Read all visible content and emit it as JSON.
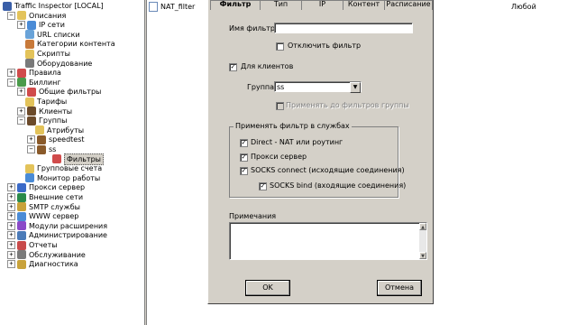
{
  "tree": {
    "items": [
      {
        "label": "Traffic Inspector [LOCAL]",
        "level": 0,
        "exp": "",
        "icon": "server-icon",
        "color": "#3a5fa8"
      },
      {
        "label": "Описания",
        "level": 1,
        "exp": "−",
        "icon": "folder-icon",
        "color": "#e3c35a"
      },
      {
        "label": "IP сети",
        "level": 2,
        "exp": "+",
        "icon": "network-icon",
        "color": "#4a8bd6"
      },
      {
        "label": "URL списки",
        "level": 2,
        "exp": "",
        "icon": "list-icon",
        "color": "#6aa3d8"
      },
      {
        "label": "Категории контента",
        "level": 2,
        "exp": "",
        "icon": "category-icon",
        "color": "#c87a3a"
      },
      {
        "label": "Скрипты",
        "level": 2,
        "exp": "",
        "icon": "script-icon",
        "color": "#e3c35a"
      },
      {
        "label": "Оборудование",
        "level": 2,
        "exp": "",
        "icon": "hardware-icon",
        "color": "#7a7a7a"
      },
      {
        "label": "Правила",
        "level": 1,
        "exp": "+",
        "icon": "rules-icon",
        "color": "#d04b4b"
      },
      {
        "label": "Биллинг",
        "level": 1,
        "exp": "−",
        "icon": "billing-icon",
        "color": "#4a9a4a"
      },
      {
        "label": "Общие фильтры",
        "level": 2,
        "exp": "+",
        "icon": "filter-icon",
        "color": "#d04b4b"
      },
      {
        "label": "Тарифы",
        "level": 2,
        "exp": "",
        "icon": "tariff-icon",
        "color": "#e3c35a"
      },
      {
        "label": "Клиенты",
        "level": 2,
        "exp": "+",
        "icon": "user-icon",
        "color": "#6b4a2a"
      },
      {
        "label": "Группы",
        "level": 2,
        "exp": "−",
        "icon": "group-icon",
        "color": "#6b4a2a"
      },
      {
        "label": "Атрибуты",
        "level": 3,
        "exp": "",
        "icon": "attribute-icon",
        "color": "#e3c35a"
      },
      {
        "label": "speedtest",
        "level": 3,
        "exp": "+",
        "icon": "group-user-icon",
        "color": "#8a5a2a"
      },
      {
        "label": "ss",
        "level": 3,
        "exp": "−",
        "icon": "group-user-icon",
        "color": "#8a5a2a"
      },
      {
        "label": "Фильтры",
        "level": 4,
        "exp": "",
        "icon": "filter-icon",
        "color": "#d04b4b",
        "selected": true
      },
      {
        "label": "Групповые счета",
        "level": 2,
        "exp": "",
        "icon": "account-icon",
        "color": "#e3c35a"
      },
      {
        "label": "Монитор работы",
        "level": 2,
        "exp": "",
        "icon": "monitor-icon",
        "color": "#4a8bd6"
      },
      {
        "label": "Прокси сервер",
        "level": 1,
        "exp": "+",
        "icon": "proxy-icon",
        "color": "#3a6ac8"
      },
      {
        "label": "Внешние сети",
        "level": 1,
        "exp": "+",
        "icon": "globe-icon",
        "color": "#2a8a4a"
      },
      {
        "label": "SMTP службы",
        "level": 1,
        "exp": "+",
        "icon": "mail-icon",
        "color": "#c8a23a"
      },
      {
        "label": "WWW сервер",
        "level": 1,
        "exp": "+",
        "icon": "www-icon",
        "color": "#4a8bd6"
      },
      {
        "label": "Модули расширения",
        "level": 1,
        "exp": "+",
        "icon": "module-icon",
        "color": "#8a4ac8"
      },
      {
        "label": "Администрирование",
        "level": 1,
        "exp": "+",
        "icon": "admin-icon",
        "color": "#4a7ab8"
      },
      {
        "label": "Отчеты",
        "level": 1,
        "exp": "+",
        "icon": "report-icon",
        "color": "#c84a4a"
      },
      {
        "label": "Обслуживание",
        "level": 1,
        "exp": "+",
        "icon": "maintenance-icon",
        "color": "#7a7a7a"
      },
      {
        "label": "Диагностика",
        "level": 1,
        "exp": "+",
        "icon": "diagnostics-icon",
        "color": "#c8a23a"
      }
    ]
  },
  "list": {
    "row_name": "NAT_filter",
    "row_value": "Любой"
  },
  "dialog": {
    "tabs": [
      "Фильтр",
      "Тип",
      "IP",
      "Контент",
      "Расписание"
    ],
    "name_label": "Имя фильтра",
    "name_value": "",
    "disable_label": "Отключить фильтр",
    "for_clients_label": "Для клиентов",
    "group_label": "Группа",
    "group_value": "ss",
    "apply_before_label": "Применять до фильтров группы",
    "services_title": "Применять фильтр в службах",
    "services": [
      {
        "label": "Direct - NAT или роутинг",
        "checked": true
      },
      {
        "label": "Прокси сервер",
        "checked": true
      },
      {
        "label": "SOCKS connect (исходящие соединения)",
        "checked": true
      },
      {
        "label": "SOCKS bind (входящие соединения)",
        "checked": true
      }
    ],
    "notes_label": "Примечания",
    "ok_label": "OK",
    "cancel_label": "Отмена",
    "check_mark": "✓",
    "combo_arrow": "▼"
  }
}
